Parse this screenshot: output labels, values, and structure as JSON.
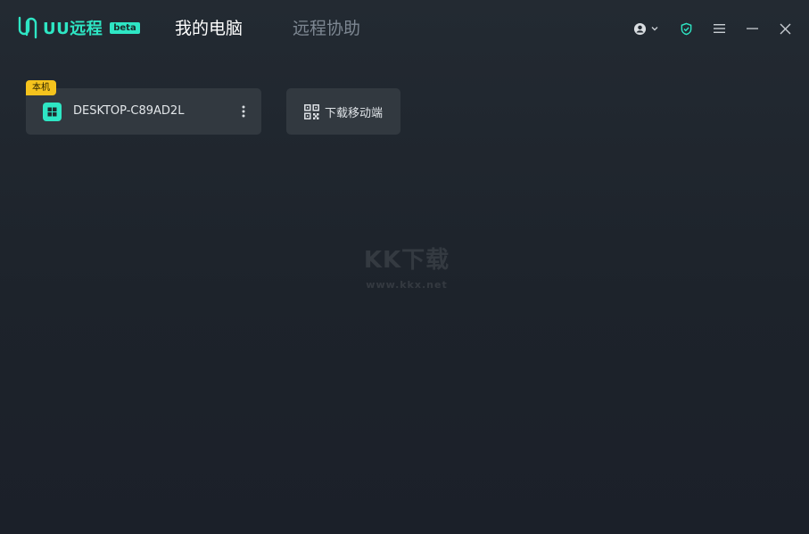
{
  "app": {
    "name": "UU远程",
    "badge": "beta",
    "accent_color": "#2ee6c4"
  },
  "tabs": [
    {
      "label": "我的电脑",
      "active": true
    },
    {
      "label": "远程协助",
      "active": false
    }
  ],
  "header_icons": [
    "user-account-icon",
    "chevron-down-icon",
    "shield-check-icon",
    "menu-icon",
    "minimize-icon",
    "close-icon"
  ],
  "devices": [
    {
      "badge": "本机",
      "name": "DESKTOP-C89AD2L",
      "icon": "windows-icon"
    }
  ],
  "download": {
    "label": "下载移动端",
    "icon": "qr-code-icon"
  },
  "watermark": {
    "main": "KK下载",
    "url": "www.kkx.net"
  }
}
